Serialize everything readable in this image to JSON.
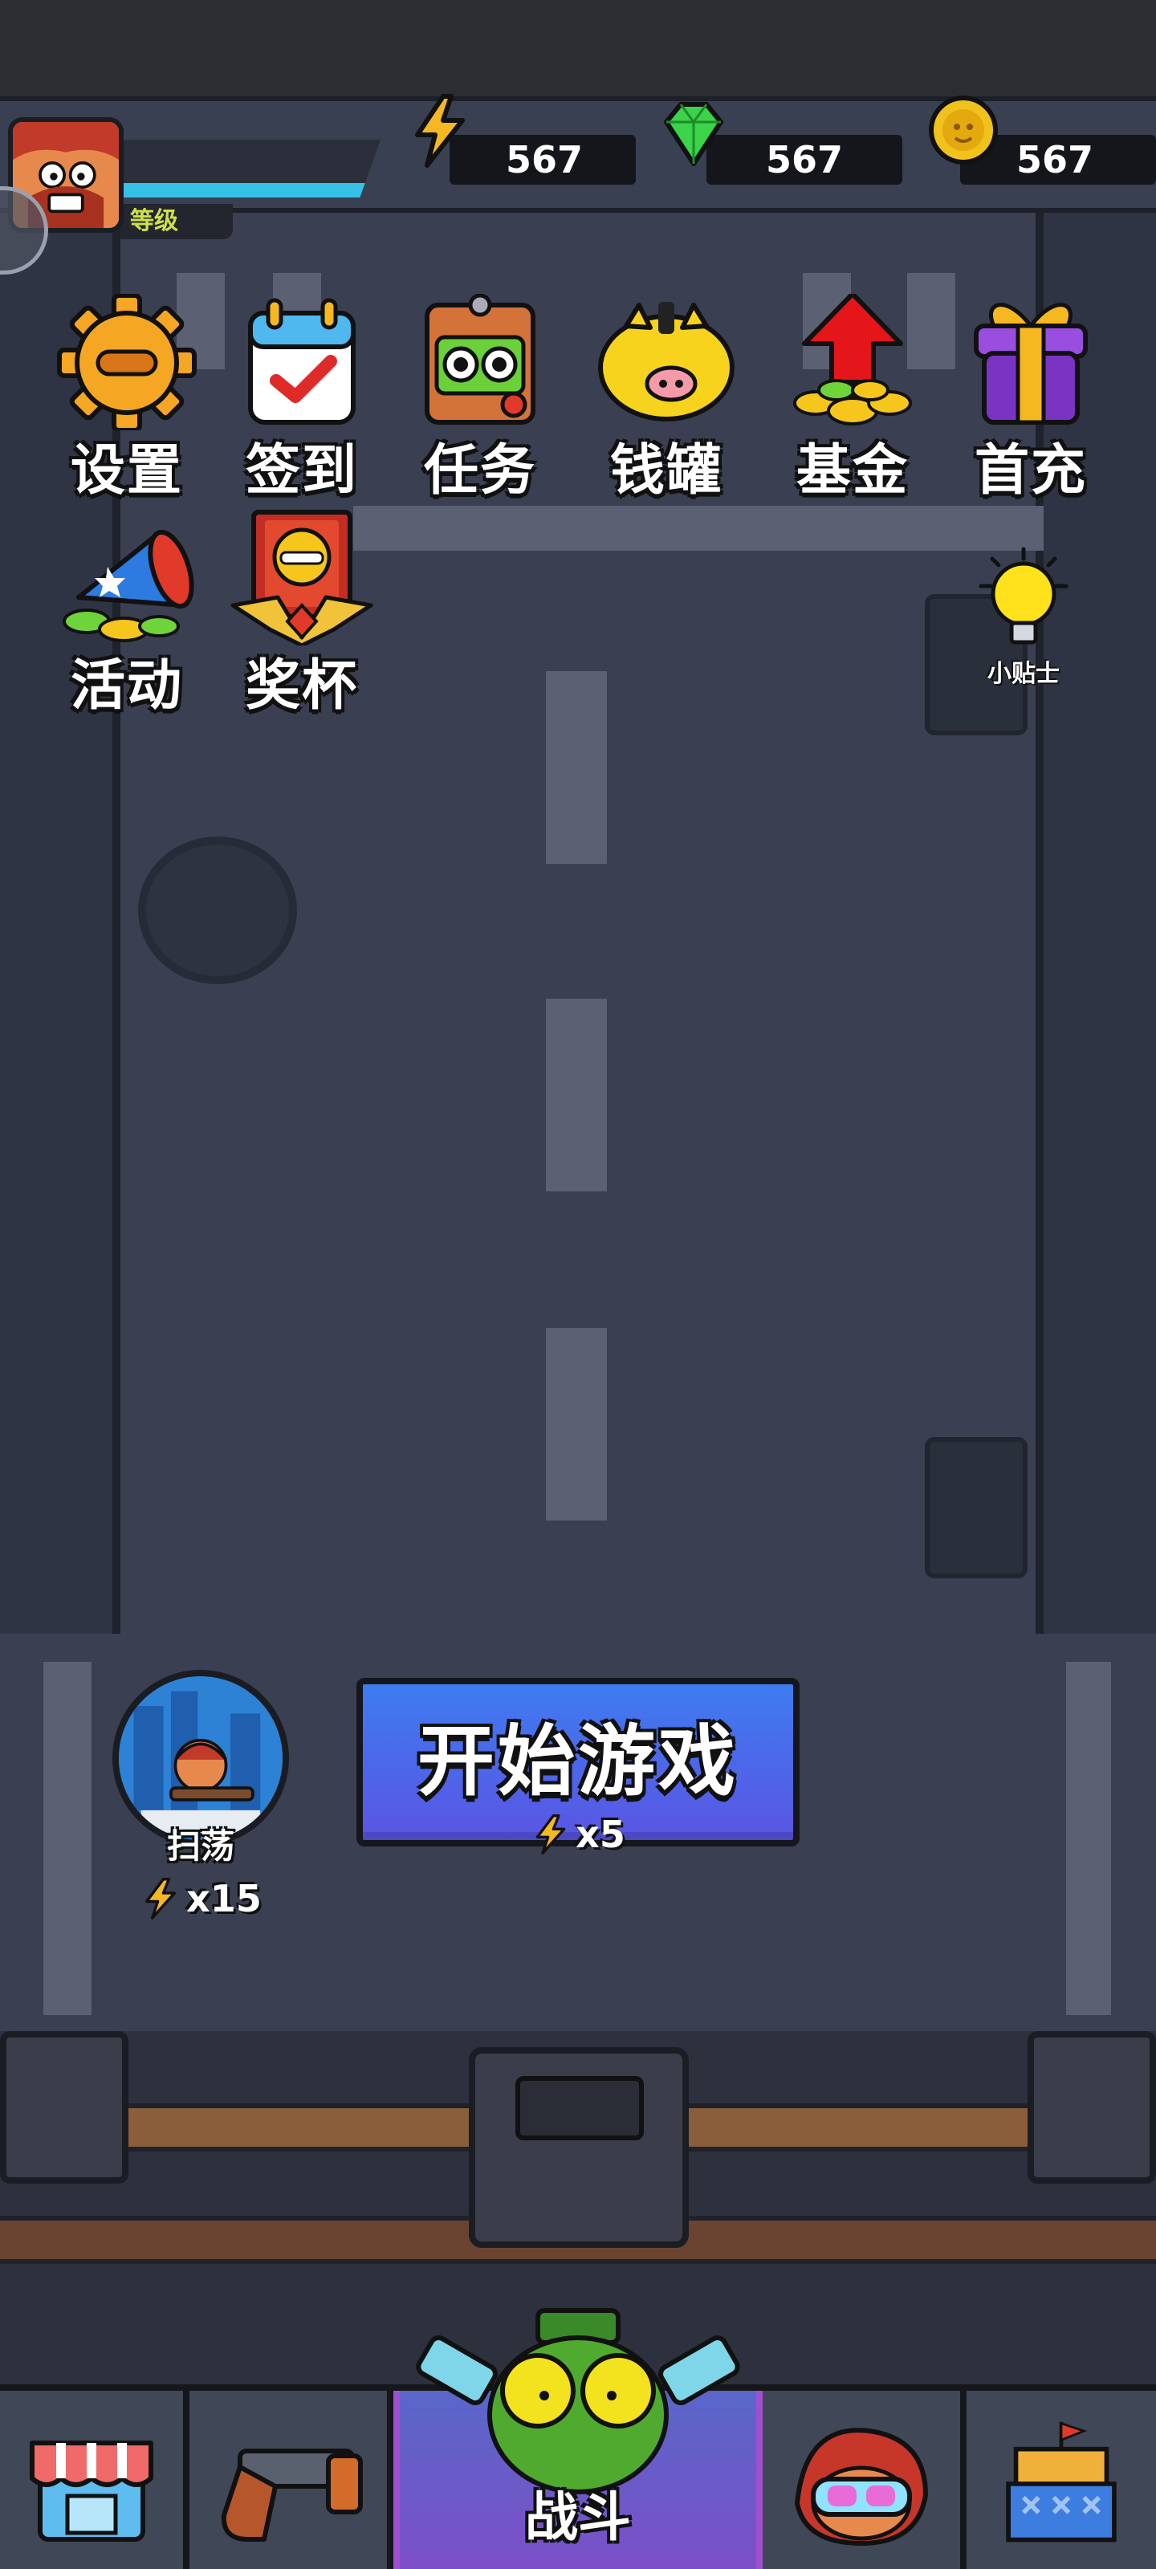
{
  "hud": {
    "level_label": "等级",
    "level_progress": 0.95,
    "energy": "567",
    "gems": "567",
    "coins": "567"
  },
  "features": [
    {
      "label": "设置",
      "icon": "gear-icon"
    },
    {
      "label": "签到",
      "icon": "calendar-check-icon"
    },
    {
      "label": "任务",
      "icon": "robot-chest-icon"
    },
    {
      "label": "钱罐",
      "icon": "piggy-bank-icon"
    },
    {
      "label": "基金",
      "icon": "coin-arrow-up-icon"
    },
    {
      "label": "首充",
      "icon": "gift-box-icon"
    },
    {
      "label": "活动",
      "icon": "megaphone-icon"
    },
    {
      "label": "奖杯",
      "icon": "trophy-banner-icon"
    }
  ],
  "tips": {
    "label": "小贴士",
    "icon": "lightbulb-icon"
  },
  "sweep": {
    "label": "扫荡",
    "cost": "x15"
  },
  "start": {
    "title": "开始游戏",
    "cost": "x5"
  },
  "nav": {
    "items": [
      {
        "label": "",
        "icon": "shop-icon"
      },
      {
        "label": "",
        "icon": "pistol-icon"
      },
      {
        "label": "战斗",
        "icon": "zombie-battle-icon"
      },
      {
        "label": "",
        "icon": "hero-goggles-icon"
      },
      {
        "label": "",
        "icon": "castle-icon"
      }
    ]
  },
  "colors": {
    "accent_blue": "#3e7bf0",
    "accent_purple": "#7e4ec7",
    "energy_yellow": "#f5b820",
    "gem_green": "#3ad34a",
    "coin_gold": "#f2c21c"
  }
}
